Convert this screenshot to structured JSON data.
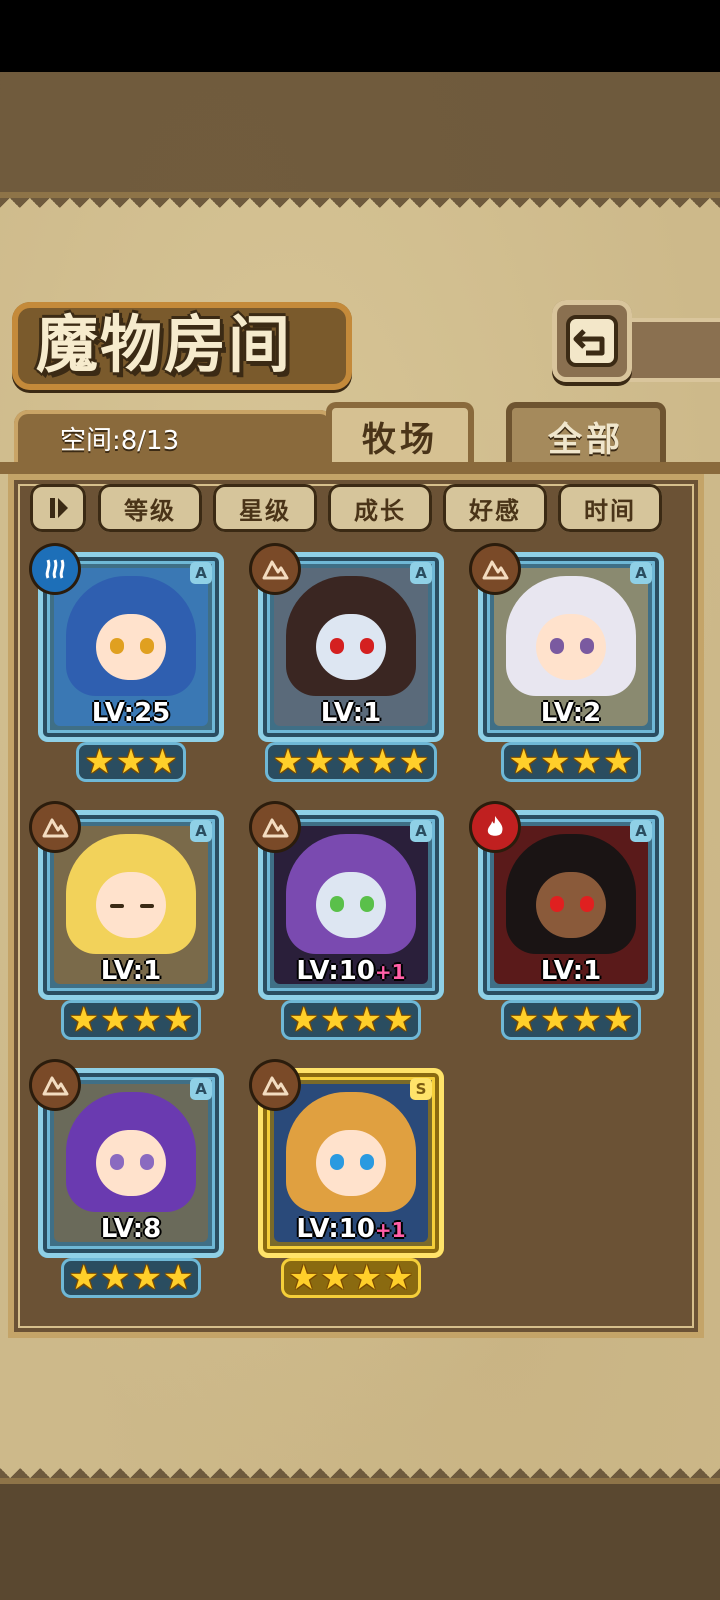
{
  "header": {
    "title": "魔物房间",
    "back_icon": "back-return-icon"
  },
  "capacity": {
    "label": "空间:8/13"
  },
  "tabs": [
    {
      "label": "牧场",
      "active": true
    },
    {
      "label": "全部",
      "active": false
    }
  ],
  "sort": {
    "toggle_icon": "sort-order-icon",
    "buttons": [
      "等级",
      "星级",
      "成长",
      "好感",
      "时间"
    ]
  },
  "monsters": [
    {
      "level": "LV:25",
      "plus": "",
      "stars": 3,
      "rank": "A",
      "element": "water-icon",
      "frame": "blue"
    },
    {
      "level": "LV:1",
      "plus": "",
      "stars": 5,
      "rank": "A",
      "element": "earth-icon",
      "frame": "blue"
    },
    {
      "level": "LV:2",
      "plus": "",
      "stars": 4,
      "rank": "A",
      "element": "earth-icon",
      "frame": "blue"
    },
    {
      "level": "LV:1",
      "plus": "",
      "stars": 4,
      "rank": "A",
      "element": "earth-icon",
      "frame": "blue"
    },
    {
      "level": "LV:10",
      "plus": "+1",
      "stars": 4,
      "rank": "A",
      "element": "earth-icon",
      "frame": "blue"
    },
    {
      "level": "LV:1",
      "plus": "",
      "stars": 4,
      "rank": "A",
      "element": "fire-icon",
      "frame": "blue"
    },
    {
      "level": "LV:8",
      "plus": "",
      "stars": 4,
      "rank": "A",
      "element": "earth-icon",
      "frame": "blue"
    },
    {
      "level": "LV:10",
      "plus": "+1",
      "stars": 4,
      "rank": "S",
      "element": "earth-icon",
      "frame": "gold"
    }
  ]
}
